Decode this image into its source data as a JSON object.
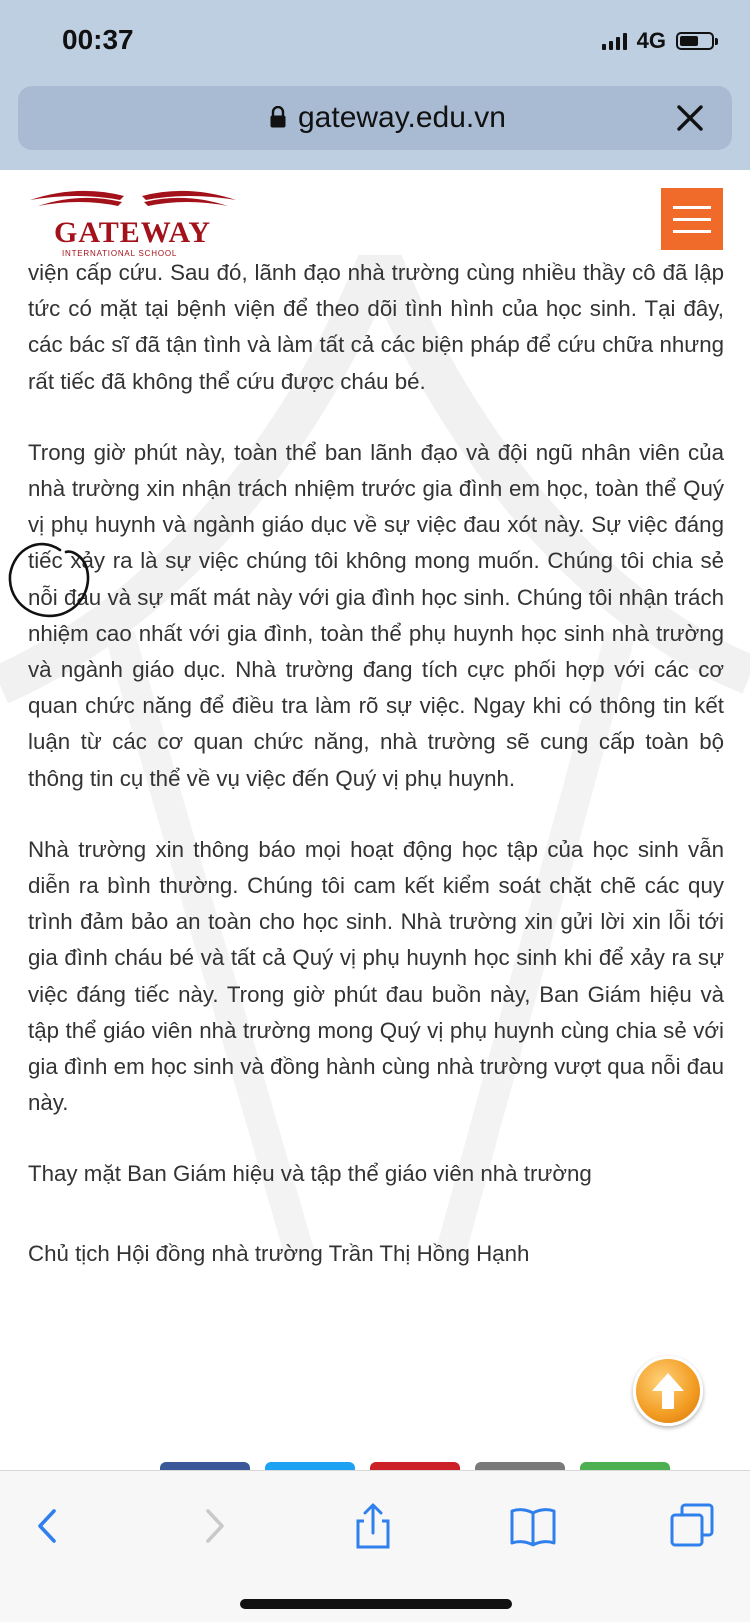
{
  "status_bar": {
    "time": "00:37",
    "network": "4G",
    "battery_level": 0.52
  },
  "url_bar": {
    "url": "gateway.edu.vn"
  },
  "site": {
    "logo_name": "GATEWAY",
    "logo_subtitle": "INTERNATIONAL SCHOOL",
    "accent_color": "#f06a2a",
    "brand_color": "#a3121a"
  },
  "article": {
    "paragraphs": [
      "viện cấp cứu. Sau đó, lãnh đạo nhà trường cùng nhiều thầy cô đã lập tức có mặt tại bệnh viện để theo dõi tình hình của học sinh. Tại đây, các bác sĩ đã tận tình và làm tất cả các biện pháp để cứu chữa nhưng rất tiếc đã không thể cứu được cháu bé.",
      "Trong giờ phút này, toàn thể ban lãnh đạo và đội ngũ nhân viên của nhà trường xin nhận trách nhiệm trước gia đình em học, toàn thể Quý vị phụ huynh và ngành giáo dục về sự việc đau xót này. Sự việc đáng tiếc xảy ra là sự việc chúng tôi không mong muốn. Chúng tôi chia sẻ nỗi đau và sự mất mát này với gia đình học sinh. Chúng tôi nhận trách nhiệm cao nhất với gia đình, toàn thể phụ huynh học sinh nhà trường và ngành giáo dục. Nhà trường đang tích cực phối hợp với các cơ quan chức năng để điều tra làm rõ sự việc. Ngay khi có thông tin kết luận từ các cơ quan chức năng, nhà trường sẽ cung cấp toàn bộ thông tin cụ thể về vụ việc đến Quý vị phụ huynh.",
      "Nhà trường xin thông báo mọi hoạt động học tập của học sinh vẫn diễn ra bình thường. Chúng tôi cam kết kiểm soát chặt chẽ các quy trình đảm bảo an toàn cho học sinh. Nhà trường xin gửi lời xin lỗi tới gia đình cháu bé và tất cả Quý vị phụ huynh học sinh khi để xảy ra sự việc đáng tiếc này. Trong giờ phút đau buồn này, Ban Giám hiệu và tập thể giáo viên nhà trường mong Quý vị phụ huynh cùng chia sẻ với gia đình em học sinh và đồng hành cùng nhà trường vượt qua nỗi đau này."
    ],
    "signature_line_1": "Thay mặt Ban Giám hiệu và tập thể giáo viên nhà trường",
    "signature_line_2": "Chủ tịch Hội đồng nhà trường Trần Thị Hồng Hạnh"
  },
  "share_colors": [
    "#3b5998",
    "#1da1f2",
    "#cc2127",
    "#7a7a7a",
    "#4caf50"
  ],
  "toolbar": {
    "icons": [
      "back-icon",
      "forward-icon",
      "share-icon",
      "bookmarks-icon",
      "tabs-icon"
    ],
    "color": "#2f80ed"
  }
}
